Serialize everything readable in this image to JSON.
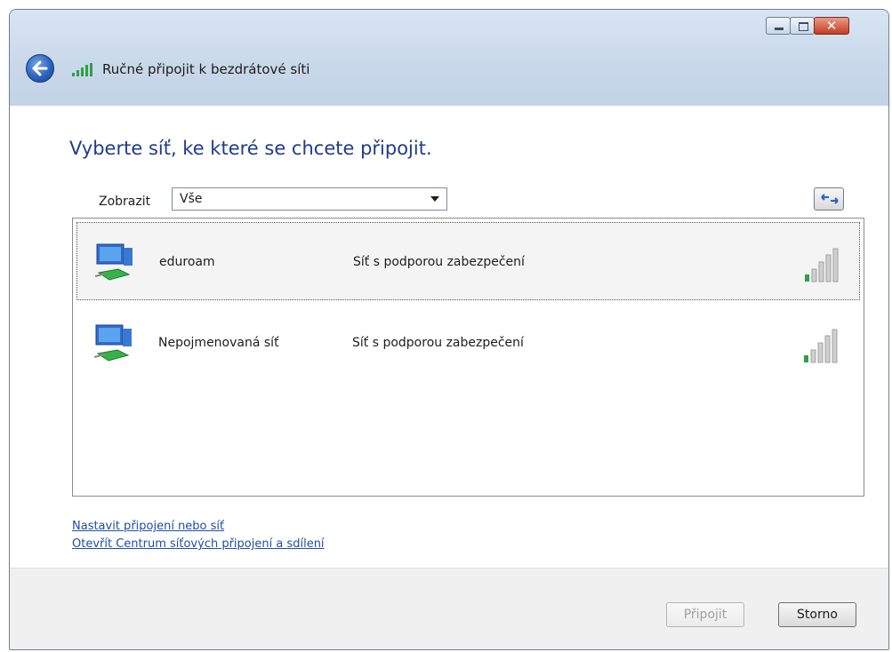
{
  "window": {
    "title": "Ručné připojit k bezdrátové síti"
  },
  "main": {
    "heading": "Vyberte síť, ke které se chcete připojit.",
    "show_label": "Zobrazit",
    "show_value": "Vše"
  },
  "networks": [
    {
      "name": "eduroam",
      "security": "Síť s podporou zabezpečení",
      "signal_bars": 1,
      "selected": true
    },
    {
      "name": "Nepojmenovaná síť",
      "security": "Síť s podporou zabezpečení",
      "signal_bars": 1,
      "selected": false
    }
  ],
  "links": {
    "setup": "Nastavit připojení nebo síť",
    "network_center": "Otevřít Centrum síťových připojení a sdílení"
  },
  "buttons": {
    "connect": "Připojit",
    "cancel": "Storno"
  },
  "colors": {
    "heading": "#1f3c8c",
    "link": "#1f4ea6",
    "signal_active": "#2ea043"
  }
}
